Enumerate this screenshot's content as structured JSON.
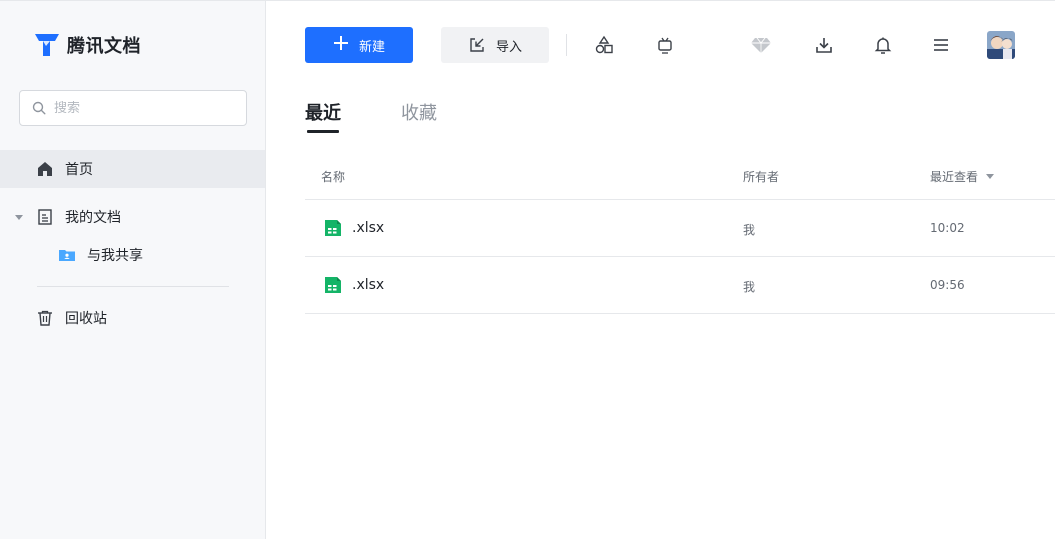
{
  "app": {
    "name": "腾讯文档"
  },
  "search": {
    "placeholder": "搜索"
  },
  "sidebar": {
    "items": [
      {
        "label": "首页",
        "icon": "home-icon",
        "active": true
      },
      {
        "label": "我的文档",
        "icon": "document-icon",
        "expanded": true
      },
      {
        "label": "与我共享",
        "icon": "shared-folder-icon"
      },
      {
        "label": "回收站",
        "icon": "trash-icon"
      }
    ]
  },
  "toolbar": {
    "new_label": "新建",
    "import_label": "导入",
    "icons": [
      "shapes-icon",
      "tv-icon",
      "diamond-icon",
      "download-icon",
      "bell-icon",
      "menu-icon",
      "avatar"
    ]
  },
  "tabs": [
    {
      "label": "最近",
      "active": true
    },
    {
      "label": "收藏",
      "active": false
    }
  ],
  "table": {
    "headers": {
      "name": "名称",
      "owner": "所有者",
      "viewed": "最近查看"
    },
    "rows": [
      {
        "name": ".xlsx",
        "owner": "我",
        "time": "10:02",
        "icon": "spreadsheet-icon"
      },
      {
        "name": ".xlsx",
        "owner": "我",
        "time": "09:56",
        "icon": "spreadsheet-icon"
      }
    ]
  },
  "colors": {
    "accent": "#1e6fff",
    "sheet_green": "#14b467",
    "sidebar_bg": "#f7f8fa",
    "active_item_bg": "#e9ebef",
    "shared_folder": "#4aa8ff"
  }
}
